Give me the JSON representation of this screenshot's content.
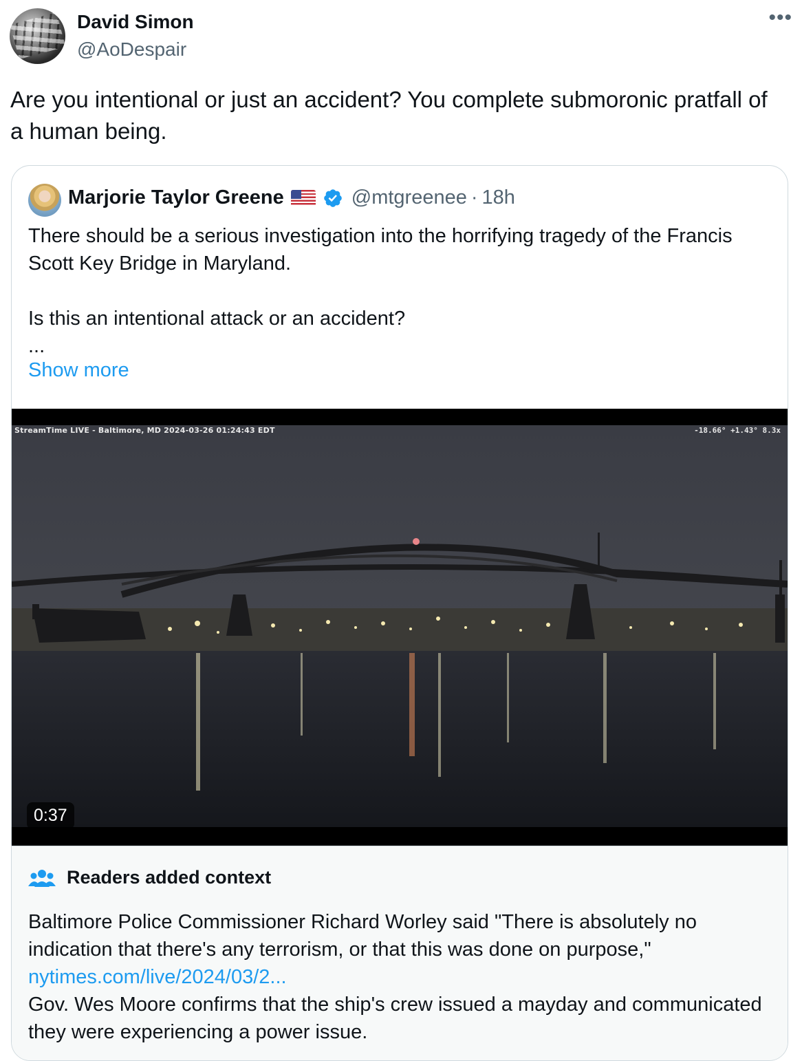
{
  "tweet": {
    "author_name": "David Simon",
    "author_handle": "@AoDespair",
    "more_icon": "•••",
    "text": "Are you intentional or just an accident? You complete submoronic pratfall of a human being."
  },
  "quote": {
    "author_name": "Marjorie Taylor Greene",
    "flag_icon": "us-flag-icon",
    "verified_icon": "verified-badge-icon",
    "handle": "@mtgreenee",
    "separator": "·",
    "time": "18h",
    "text_line1": "There should be a serious investigation into the horrifying tragedy of the Francis Scott Key Bridge in Maryland.",
    "text_line2": "Is this an intentional attack or an accident?",
    "ellipsis": "...",
    "show_more": "Show more"
  },
  "video": {
    "overlay_left": "StreamTime LIVE - Baltimore, MD 2024-03-26  01:24:43 EDT",
    "overlay_right": "-18.66°  +1.43°  8.3x",
    "duration": "0:37"
  },
  "context": {
    "icon": "readers-people-icon",
    "heading": "Readers added context",
    "body1": "Baltimore Police Commissioner Richard Worley said \"There is absolutely no indication that there's any terrorism, or that this was done on purpose,\"",
    "link": "nytimes.com/live/2024/03/2...",
    "body2": "Gov. Wes Moore confirms that the ship's crew issued a mayday and communicated they were experiencing a power issue."
  },
  "colors": {
    "text": "#0f1419",
    "secondary": "#536471",
    "link": "#1d9bf0",
    "border": "#cfd9de",
    "context_bg": "#f7f9f9"
  }
}
